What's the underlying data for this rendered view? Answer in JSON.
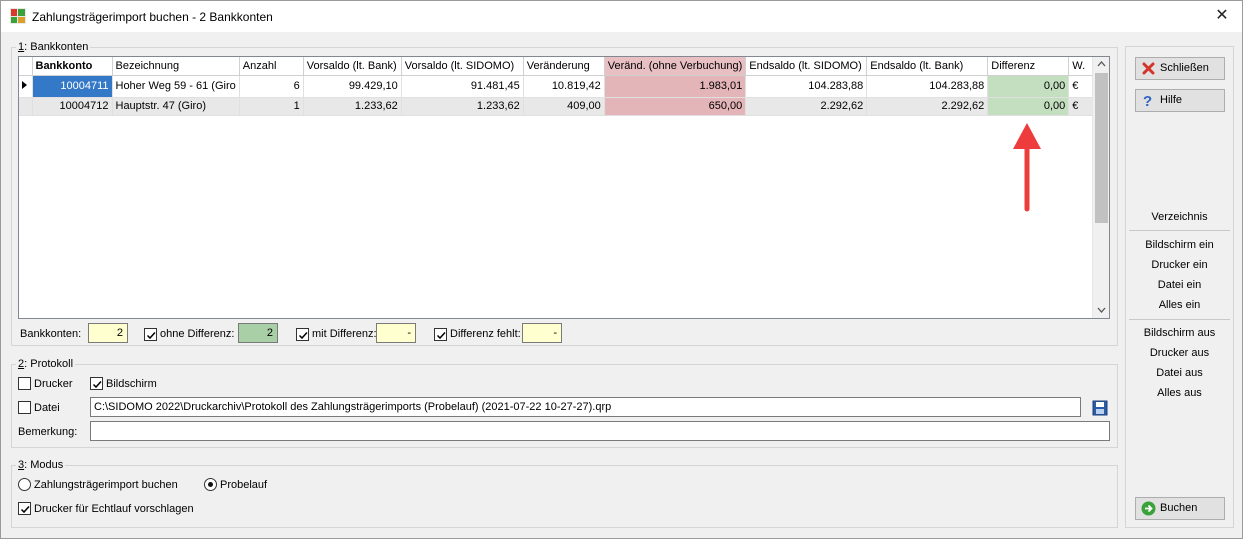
{
  "window": {
    "title": "Zahlungsträgerimport buchen - 2 Bankkonten",
    "close_glyph": "✕"
  },
  "bankkonten": {
    "legend_num": "1",
    "legend_text": ": Bankkonten",
    "columns": [
      "",
      "Bankkonto",
      "Bezeichnung",
      "Anzahl",
      "Vorsaldo (lt. Bank)",
      "Vorsaldo (lt. SIDOMO)",
      "Veränderung",
      "Veränd. (ohne Verbuchung)",
      "Endsaldo (lt. SIDOMO)",
      "Endsaldo (lt. Bank)",
      "Differenz",
      "W."
    ],
    "rows": [
      [
        "",
        "10004711",
        "Hoher Weg 59 - 61 (Giro",
        "6",
        "99.429,10",
        "91.481,45",
        "10.819,42",
        "1.983,01",
        "104.283,88",
        "104.283,88",
        "0,00",
        "€"
      ],
      [
        "",
        "10004712",
        "Hauptstr. 47 (Giro)",
        "1",
        "1.233,62",
        "1.233,62",
        "409,00",
        "650,00",
        "2.292,62",
        "2.292,62",
        "0,00",
        "€"
      ]
    ],
    "summary": {
      "bankkonten_label": "Bankkonten:",
      "bankkonten_value": "2",
      "ohne_label": "ohne Differenz:",
      "ohne_value": "2",
      "ohne_checked": true,
      "mit_label": "mit Differenz:",
      "mit_value": "-",
      "mit_checked": true,
      "fehlt_label": "Differenz fehlt:",
      "fehlt_value": "-",
      "fehlt_checked": true
    }
  },
  "protokoll": {
    "legend_num": "2",
    "legend_text": ": Protokoll",
    "drucker_label": "Drucker",
    "drucker_checked": false,
    "bildschirm_label": "Bildschirm",
    "bildschirm_checked": true,
    "datei_label": "Datei",
    "datei_checked": false,
    "datei_path": "C:\\SIDOMO 2022\\Druckarchiv\\Protokoll des Zahlungsträgerimports  (Probelauf) (2021-07-22 10-27-27).qrp",
    "bemerkung_label": "Bemerkung:",
    "bemerkung_value": ""
  },
  "modus": {
    "legend_num": "3",
    "legend_text": ": Modus",
    "option_buchen": "Zahlungsträgerimport buchen",
    "option_probelauf": "Probelauf",
    "selected": "Probelauf",
    "drucker_vorschlagen_label": "Drucker für Echtlauf vorschlagen",
    "drucker_vorschlagen_checked": true
  },
  "right_panel": {
    "schliessen_label": "Schließen",
    "hilfe_label": "Hilfe",
    "verzeichnis_label": "Verzeichnis",
    "ein_items": [
      "Bildschirm ein",
      "Drucker ein",
      "Datei ein",
      "Alles ein"
    ],
    "aus_items": [
      "Bildschirm aus",
      "Drucker aus",
      "Datei aus",
      "Alles aus"
    ],
    "buchen_label": "Buchen"
  },
  "colors": {
    "highlight_pink": "#e4b5b8",
    "highlight_green": "#c4dfc0",
    "annotation_arrow": "#ee3b3b",
    "selection_blue": "#3479c7"
  }
}
